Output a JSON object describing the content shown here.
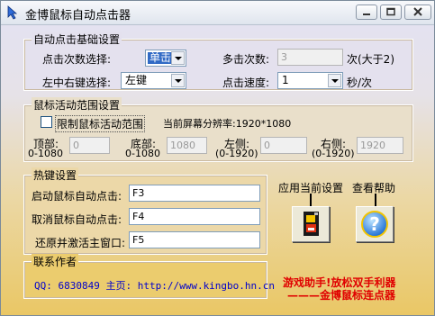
{
  "window": {
    "title": "金博鼠标自动点击器",
    "controls": [
      "minimize-icon",
      "maximize-icon",
      "close-icon"
    ]
  },
  "basic": {
    "title": "自动点击基础设置",
    "click_count_label": "点击次数选择:",
    "click_count_value": "单击",
    "multi_click_label": "多击次数:",
    "multi_click_value": "3",
    "multi_click_unit": "次(大于2)",
    "button_label": "左中右键选择:",
    "button_value": "左键",
    "speed_label": "点击速度:",
    "speed_value": "1",
    "speed_unit": "秒/次"
  },
  "range": {
    "title": "鼠标活动范围设置",
    "limit_label": "限制鼠标活动范围",
    "limit_checked": false,
    "resolution_text": "当前屏幕分辨率:1920*1080",
    "top_label": "顶部:",
    "top_range": "0-1080",
    "top_value": "0",
    "bottom_label": "底部:",
    "bottom_range": "0-1080",
    "bottom_value": "1080",
    "left_label": "左侧:",
    "left_range": "(0-1920)",
    "left_value": "0",
    "right_label": "右侧:",
    "right_range": "(0-1920)",
    "right_value": "1920"
  },
  "hotkeys": {
    "title": "热键设置",
    "start_label": "启动鼠标自动点击:",
    "start_value": "F3",
    "cancel_label": "取消鼠标自动点击:",
    "cancel_value": "F4",
    "restore_label": "还原并激活主窗口:",
    "restore_value": "F5"
  },
  "actions": {
    "apply_label": "应用当前设置",
    "help_label": "查看帮助",
    "apply_icon": "floppy-disk-icon",
    "help_icon": "question-mark-icon"
  },
  "contact": {
    "title": "联系作者",
    "text": "QQ: 6830849 主页: http://www.kingbo.hn.cn"
  },
  "promo": {
    "line1": "游戏助手!放松双手利器",
    "line2": "———金博鼠标连点器"
  },
  "colors": {
    "selection": "#316ac5",
    "promo": "#e00000",
    "contact": "#0000cc"
  }
}
